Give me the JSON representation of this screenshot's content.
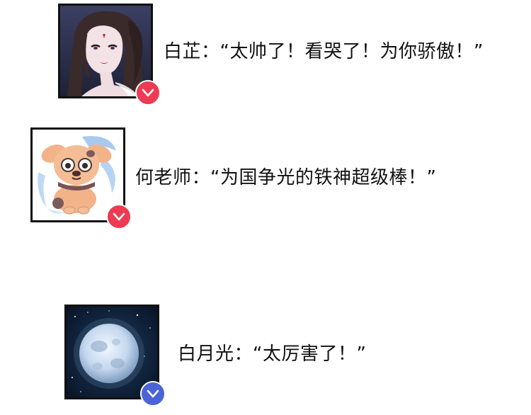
{
  "comments": [
    {
      "author": "白芷",
      "separator": "：",
      "text": "“太帅了！看哭了！为你骄傲！”",
      "avatar_icon": "woman-portrait-avatar",
      "badge_icon": "verified-v-icon",
      "badge_color": "#ec3b52"
    },
    {
      "author": "何老师",
      "separator": "：",
      "text": "“为国争光的铁神超级棒！”",
      "avatar_icon": "puppy-cartoon-avatar",
      "badge_icon": "verified-v-icon",
      "badge_color": "#ec3b52"
    },
    {
      "author": "白月光",
      "separator": "：",
      "text": "“太厉害了！”",
      "avatar_icon": "moon-night-avatar",
      "badge_icon": "verified-v-icon",
      "badge_color": "#4a63d6"
    }
  ]
}
